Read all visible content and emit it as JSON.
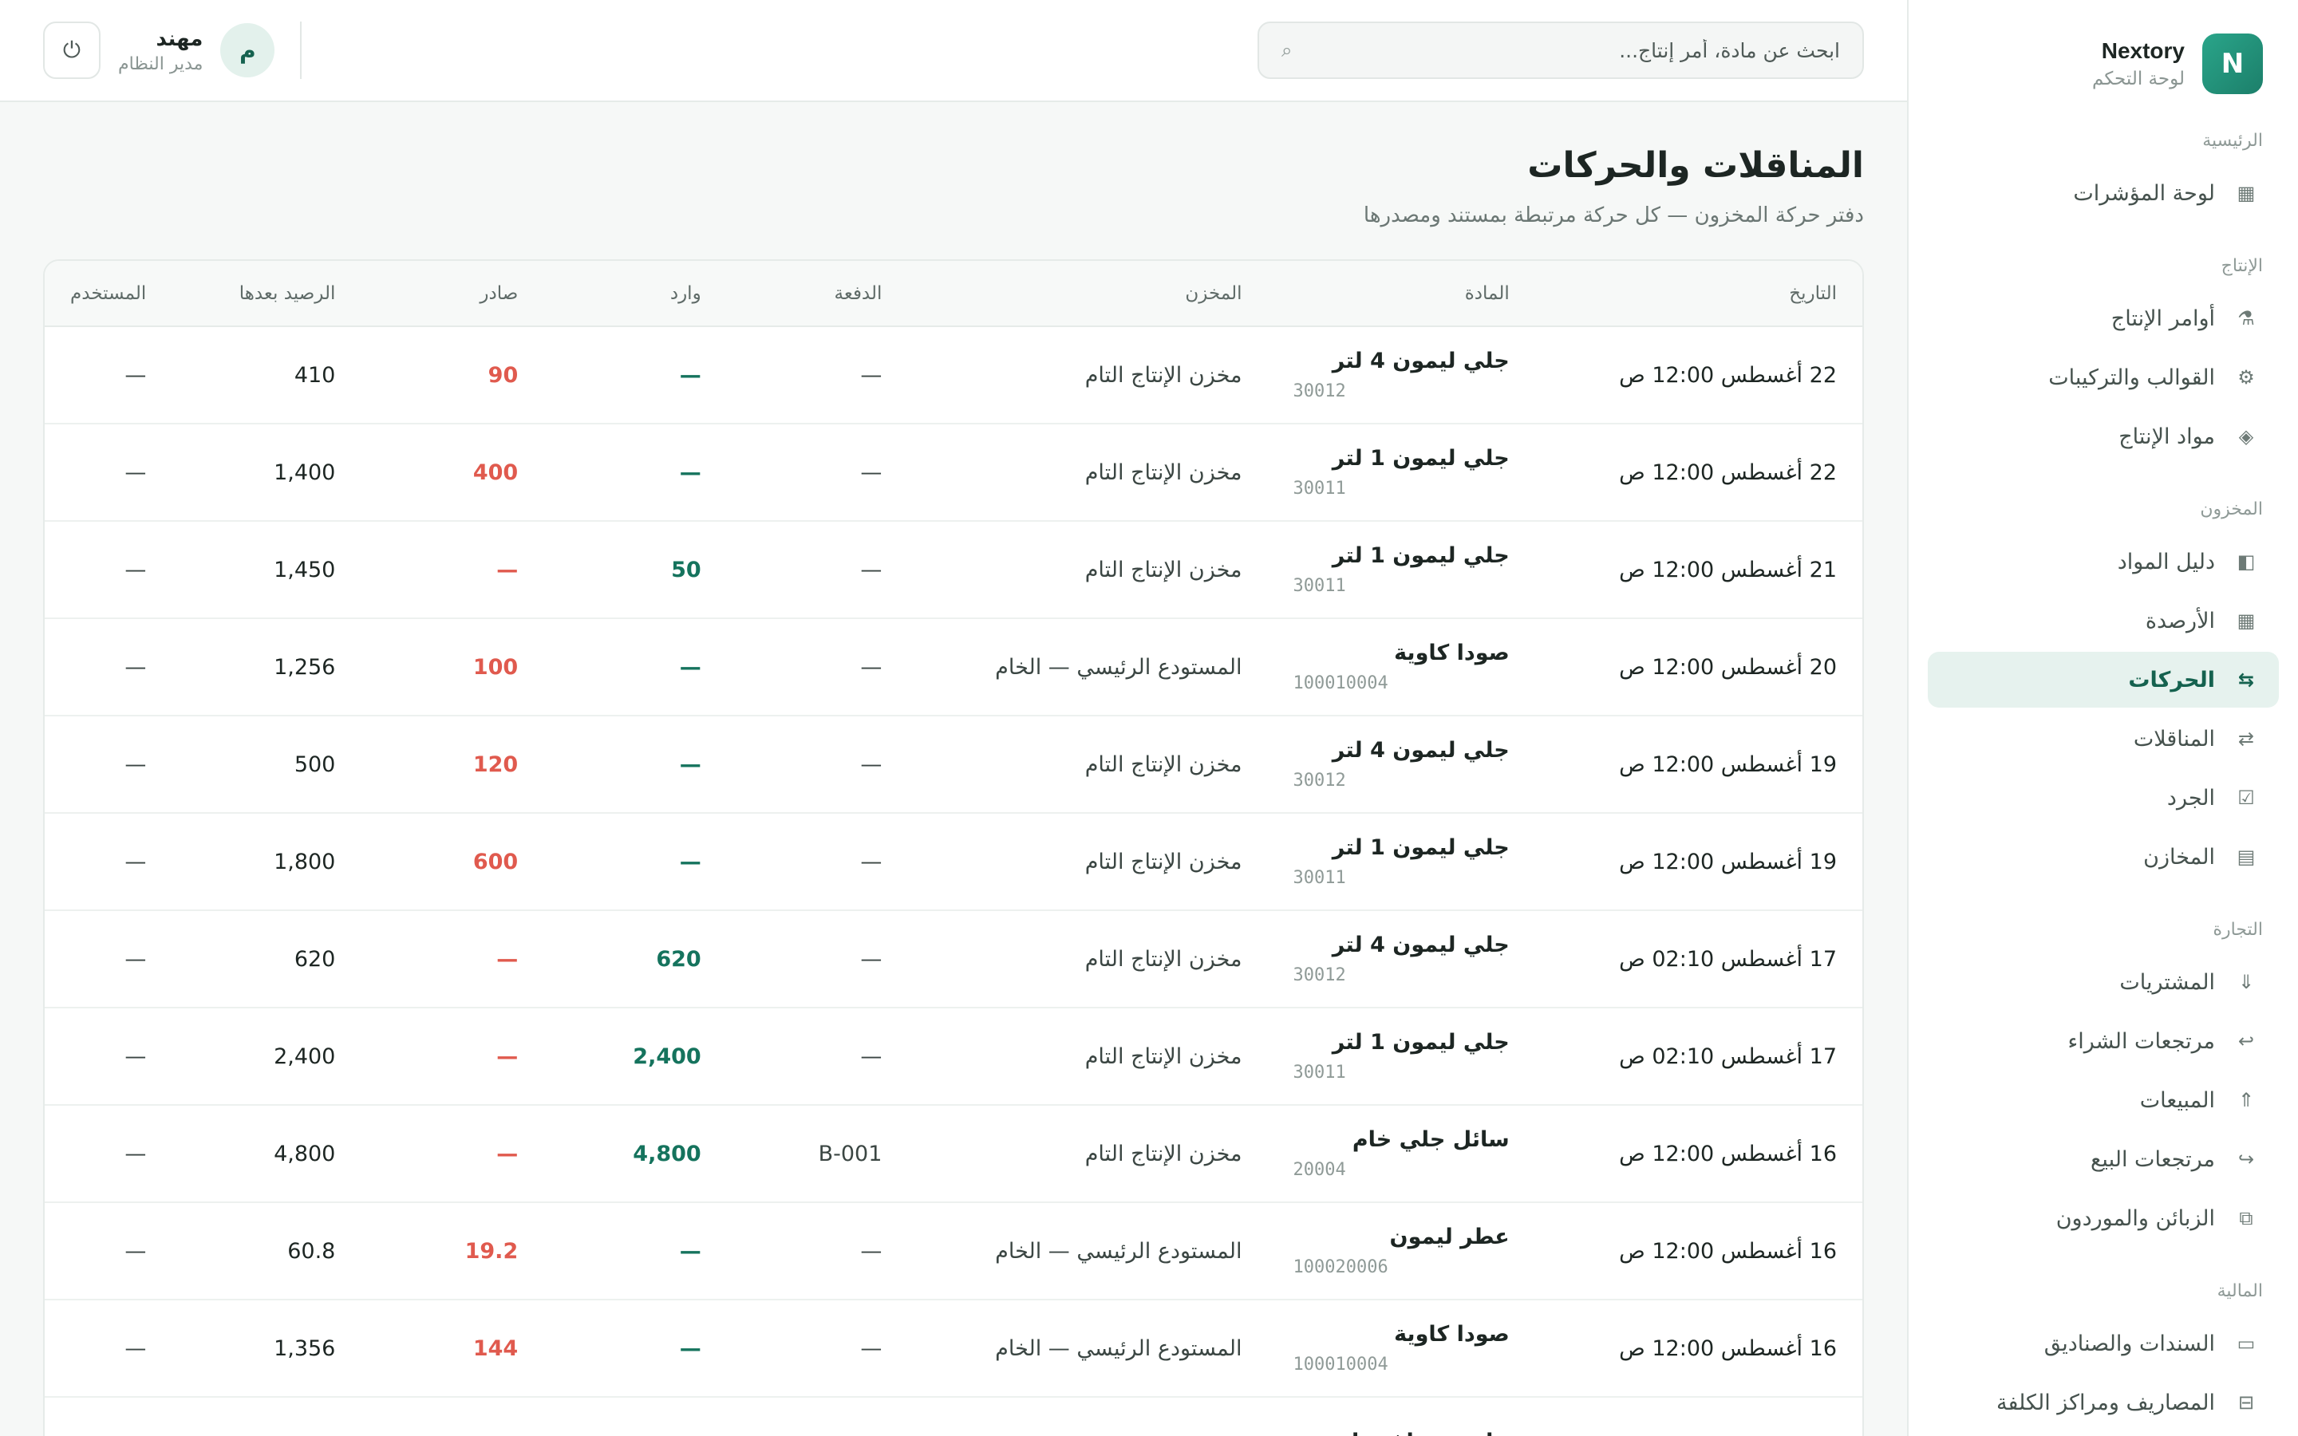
{
  "sidebar": {
    "brand_name": "Nextory",
    "brand_sub": "لوحة التحكم",
    "brand_letter": "N",
    "sections": [
      {
        "label": "الرئيسية",
        "items": [
          {
            "label": "لوحة المؤشرات",
            "icon": "grid-icon",
            "glyph": "▦"
          }
        ]
      },
      {
        "label": "الإنتاج",
        "items": [
          {
            "label": "أوامر الإنتاج",
            "icon": "factory-icon",
            "glyph": "⚗"
          },
          {
            "label": "القوالب والتركيبات",
            "icon": "gear-icon",
            "glyph": "⚙"
          },
          {
            "label": "مواد الإنتاج",
            "icon": "diamond-icon",
            "glyph": "◈"
          }
        ]
      },
      {
        "label": "المخزون",
        "items": [
          {
            "label": "دليل المواد",
            "icon": "book-icon",
            "glyph": "◧"
          },
          {
            "label": "الأرصدة",
            "icon": "grid-icon",
            "glyph": "▦"
          },
          {
            "label": "الحركات",
            "icon": "movements-icon",
            "glyph": "⇆",
            "active": true
          },
          {
            "label": "المناقلات",
            "icon": "transfer-icon",
            "glyph": "⇄"
          },
          {
            "label": "الجرد",
            "icon": "checkbox-icon",
            "glyph": "☑"
          },
          {
            "label": "المخازن",
            "icon": "warehouse-icon",
            "glyph": "▤"
          }
        ]
      },
      {
        "label": "التجارة",
        "items": [
          {
            "label": "المشتريات",
            "icon": "arrow-down-icon",
            "glyph": "⇓"
          },
          {
            "label": "مرتجعات الشراء",
            "icon": "return-icon",
            "glyph": "↩"
          },
          {
            "label": "المبيعات",
            "icon": "arrow-up-icon",
            "glyph": "⇑"
          },
          {
            "label": "مرتجعات البيع",
            "icon": "redo-icon",
            "glyph": "↪"
          },
          {
            "label": "الزبائن والموردون",
            "icon": "people-icon",
            "glyph": "⧉"
          }
        ]
      },
      {
        "label": "المالية",
        "items": [
          {
            "label": "السندات والصناديق",
            "icon": "cash-icon",
            "glyph": "▭"
          },
          {
            "label": "المصاريف ومراكز الكلفة",
            "icon": "expense-icon",
            "glyph": "⊟"
          }
        ]
      }
    ]
  },
  "topbar": {
    "search_placeholder": "ابحث عن مادة، أمر إنتاج...",
    "user_name": "مهند",
    "user_role": "مدير النظام",
    "avatar_letter": "م"
  },
  "page": {
    "title": "المناقلات والحركات",
    "subtitle": "دفتر حركة المخزون — كل حركة مرتبطة بمستند ومصدرها"
  },
  "table": {
    "headers": {
      "date": "التاريخ",
      "item": "المادة",
      "warehouse": "المخزن",
      "batch": "الدفعة",
      "in": "وارد",
      "out": "صادر",
      "balance": "الرصيد بعدها",
      "user": "المستخدم"
    },
    "rows": [
      {
        "date": "22 أغسطس 12:00 ص",
        "item": "جلي ليمون 4 لتر",
        "code": "30012",
        "warehouse": "مخزن الإنتاج التام",
        "batch": "—",
        "in": "—",
        "out": "90",
        "balance": "410",
        "user": "—"
      },
      {
        "date": "22 أغسطس 12:00 ص",
        "item": "جلي ليمون 1 لتر",
        "code": "30011",
        "warehouse": "مخزن الإنتاج التام",
        "batch": "—",
        "in": "—",
        "out": "400",
        "balance": "1,400",
        "user": "—"
      },
      {
        "date": "21 أغسطس 12:00 ص",
        "item": "جلي ليمون 1 لتر",
        "code": "30011",
        "warehouse": "مخزن الإنتاج التام",
        "batch": "—",
        "in": "50",
        "out": "—",
        "balance": "1,450",
        "user": "—"
      },
      {
        "date": "20 أغسطس 12:00 ص",
        "item": "صودا كاوية",
        "code": "100010004",
        "warehouse": "المستودع الرئيسي — الخام",
        "batch": "—",
        "in": "—",
        "out": "100",
        "balance": "1,256",
        "user": "—"
      },
      {
        "date": "19 أغسطس 12:00 ص",
        "item": "جلي ليمون 4 لتر",
        "code": "30012",
        "warehouse": "مخزن الإنتاج التام",
        "batch": "—",
        "in": "—",
        "out": "120",
        "balance": "500",
        "user": "—"
      },
      {
        "date": "19 أغسطس 12:00 ص",
        "item": "جلي ليمون 1 لتر",
        "code": "30011",
        "warehouse": "مخزن الإنتاج التام",
        "batch": "—",
        "in": "—",
        "out": "600",
        "balance": "1,800",
        "user": "—"
      },
      {
        "date": "17 أغسطس 02:10 ص",
        "item": "جلي ليمون 4 لتر",
        "code": "30012",
        "warehouse": "مخزن الإنتاج التام",
        "batch": "—",
        "in": "620",
        "out": "—",
        "balance": "620",
        "user": "—"
      },
      {
        "date": "17 أغسطس 02:10 ص",
        "item": "جلي ليمون 1 لتر",
        "code": "30011",
        "warehouse": "مخزن الإنتاج التام",
        "batch": "—",
        "in": "2,400",
        "out": "—",
        "balance": "2,400",
        "user": "—"
      },
      {
        "date": "16 أغسطس 12:00 ص",
        "item": "سائل جلي خام",
        "code": "20004",
        "warehouse": "مخزن الإنتاج التام",
        "batch": "B-001",
        "in": "4,800",
        "out": "—",
        "balance": "4,800",
        "user": "—"
      },
      {
        "date": "16 أغسطس 12:00 ص",
        "item": "عطر ليمون",
        "code": "100020006",
        "warehouse": "المستودع الرئيسي — الخام",
        "batch": "—",
        "in": "—",
        "out": "19.2",
        "balance": "60.8",
        "user": "—"
      },
      {
        "date": "16 أغسطس 12:00 ص",
        "item": "صودا كاوية",
        "code": "100010004",
        "warehouse": "المستودع الرئيسي — الخام",
        "batch": "—",
        "in": "—",
        "out": "144",
        "balance": "1,356",
        "user": "—"
      },
      {
        "date": "",
        "item": "حامض سلفونيك",
        "code": "",
        "warehouse": "",
        "batch": "",
        "in": "",
        "out": "",
        "balance": "",
        "user": ""
      }
    ]
  },
  "colors": {
    "accent": "#15624f",
    "in": "#15735d",
    "out": "#e05a4e"
  }
}
